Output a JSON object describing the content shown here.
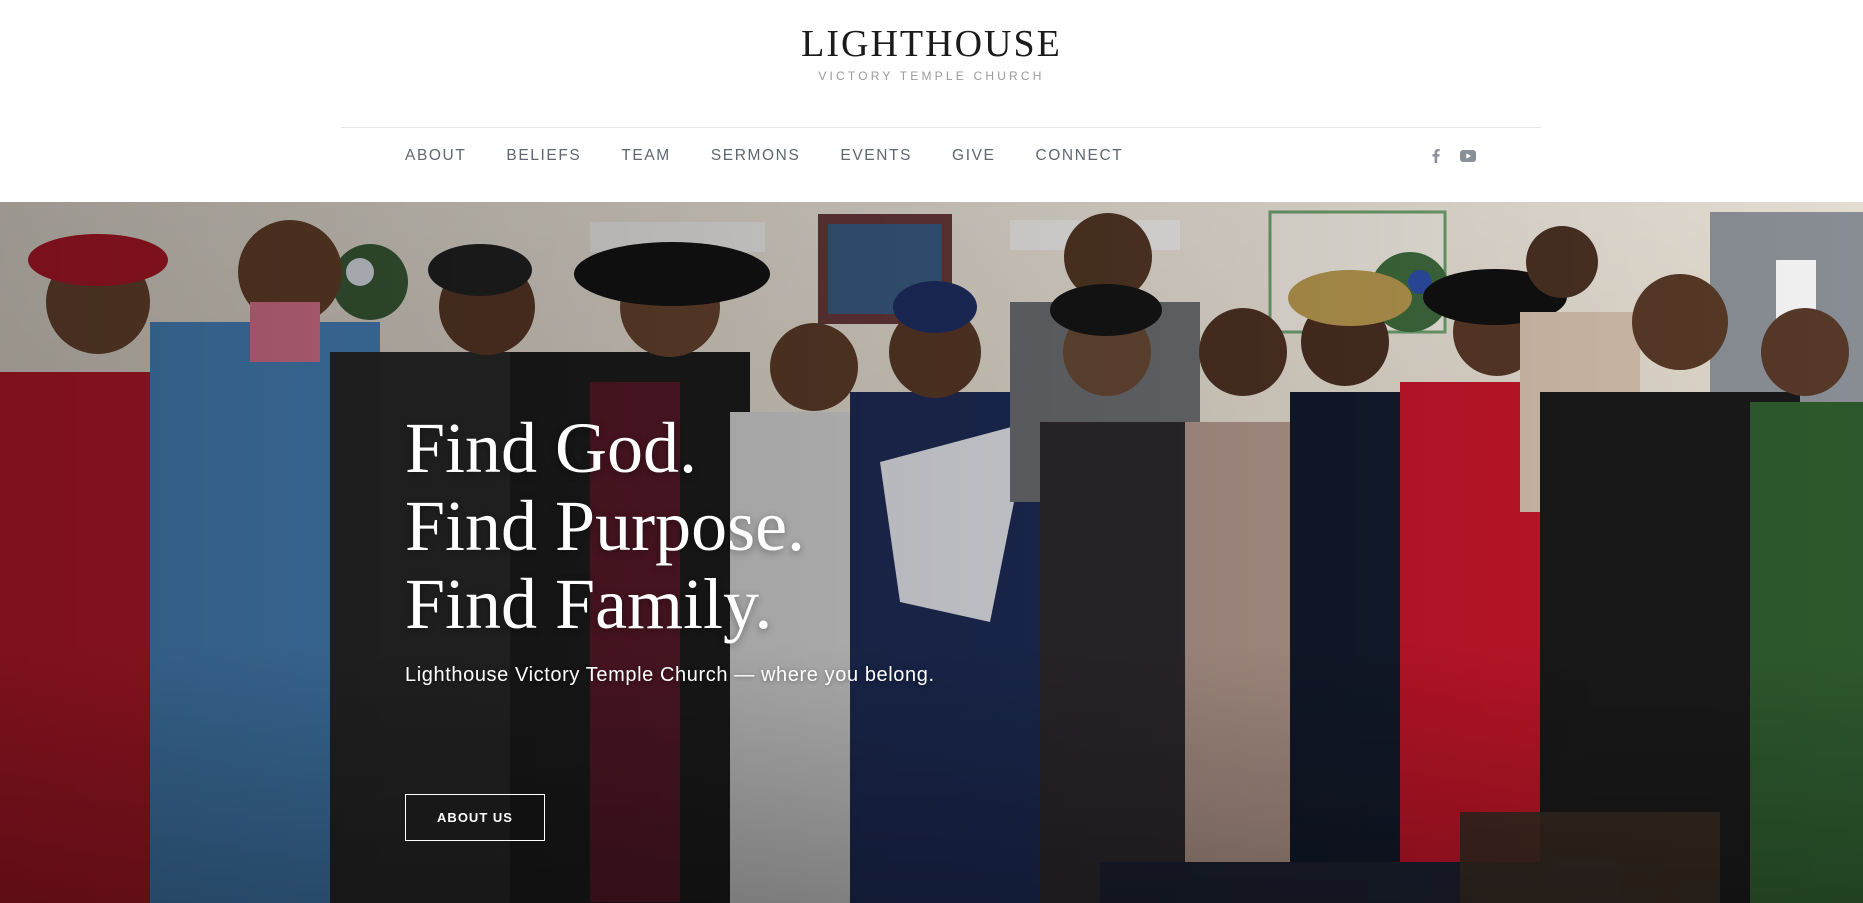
{
  "brand": {
    "title": "LIGHTHOUSE",
    "subtitle": "VICTORY TEMPLE CHURCH"
  },
  "nav": {
    "items": [
      {
        "label": "ABOUT"
      },
      {
        "label": "BELIEFS"
      },
      {
        "label": "TEAM"
      },
      {
        "label": "SERMONS"
      },
      {
        "label": "EVENTS"
      },
      {
        "label": "GIVE"
      },
      {
        "label": "CONNECT"
      }
    ],
    "socials": [
      {
        "icon": "facebook-icon"
      },
      {
        "icon": "youtube-icon"
      }
    ]
  },
  "hero": {
    "headline_lines": [
      "Find God.",
      "Find Purpose.",
      "Find Family."
    ],
    "subtitle": "Lighthouse Victory Temple Church — where you belong.",
    "button_label": "ABOUT US",
    "photo_alt_icon": "congregation-photo"
  },
  "colors": {
    "text_dark": "#1b1b1b",
    "nav_text": "#5f6670",
    "muted": "#9a9a9a",
    "hero_text": "#ffffff"
  }
}
